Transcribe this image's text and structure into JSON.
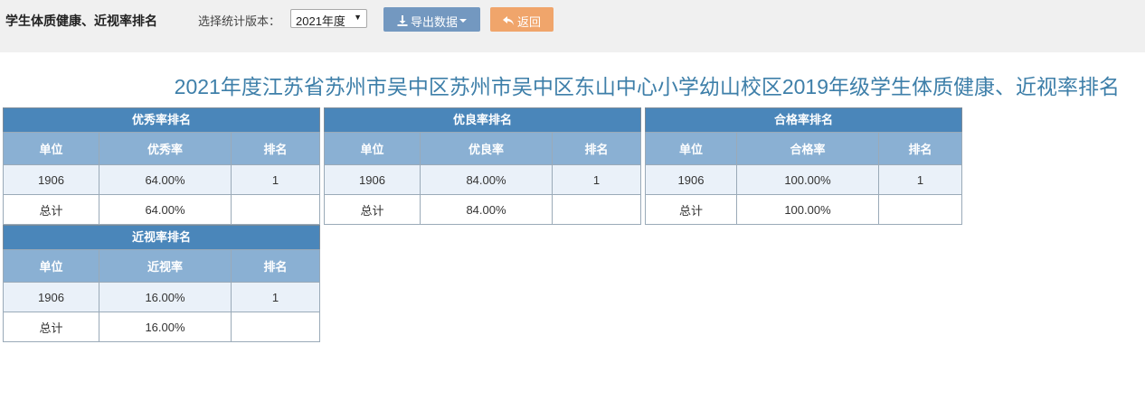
{
  "header": {
    "page_name": "学生体质健康、近视率排名",
    "version_label": "选择统计版本：",
    "version_selected": "2021年度",
    "export_label": "导出数据",
    "back_label": "返回"
  },
  "report_title": "2021年度江苏省苏州市吴中区苏州市吴中区东山中心小学幼山校区2019年级学生体质健康、近视率排名",
  "tables": [
    {
      "title": "优秀率排名",
      "headers": [
        "单位",
        "优秀率",
        "排名"
      ],
      "rows": [
        [
          "1906",
          "64.00%",
          "1"
        ],
        [
          "总计",
          "64.00%",
          ""
        ]
      ]
    },
    {
      "title": "优良率排名",
      "headers": [
        "单位",
        "优良率",
        "排名"
      ],
      "rows": [
        [
          "1906",
          "84.00%",
          "1"
        ],
        [
          "总计",
          "84.00%",
          ""
        ]
      ]
    },
    {
      "title": "合格率排名",
      "headers": [
        "单位",
        "合格率",
        "排名"
      ],
      "rows": [
        [
          "1906",
          "100.00%",
          "1"
        ],
        [
          "总计",
          "100.00%",
          ""
        ]
      ]
    },
    {
      "title": "近视率排名",
      "headers": [
        "单位",
        "近视率",
        "排名"
      ],
      "rows": [
        [
          "1906",
          "16.00%",
          "1"
        ],
        [
          "总计",
          "16.00%",
          ""
        ]
      ]
    }
  ],
  "icons": {
    "export": "download-icon",
    "dropdown": "caret-down-icon",
    "back": "reply-arrow-icon"
  },
  "colors": {
    "table_title_bg": "#4a86ba",
    "table_header_bg": "#8ab0d3",
    "export_button": "#7398c0",
    "back_button": "#f0a56b",
    "report_title": "#3e7fa9"
  }
}
